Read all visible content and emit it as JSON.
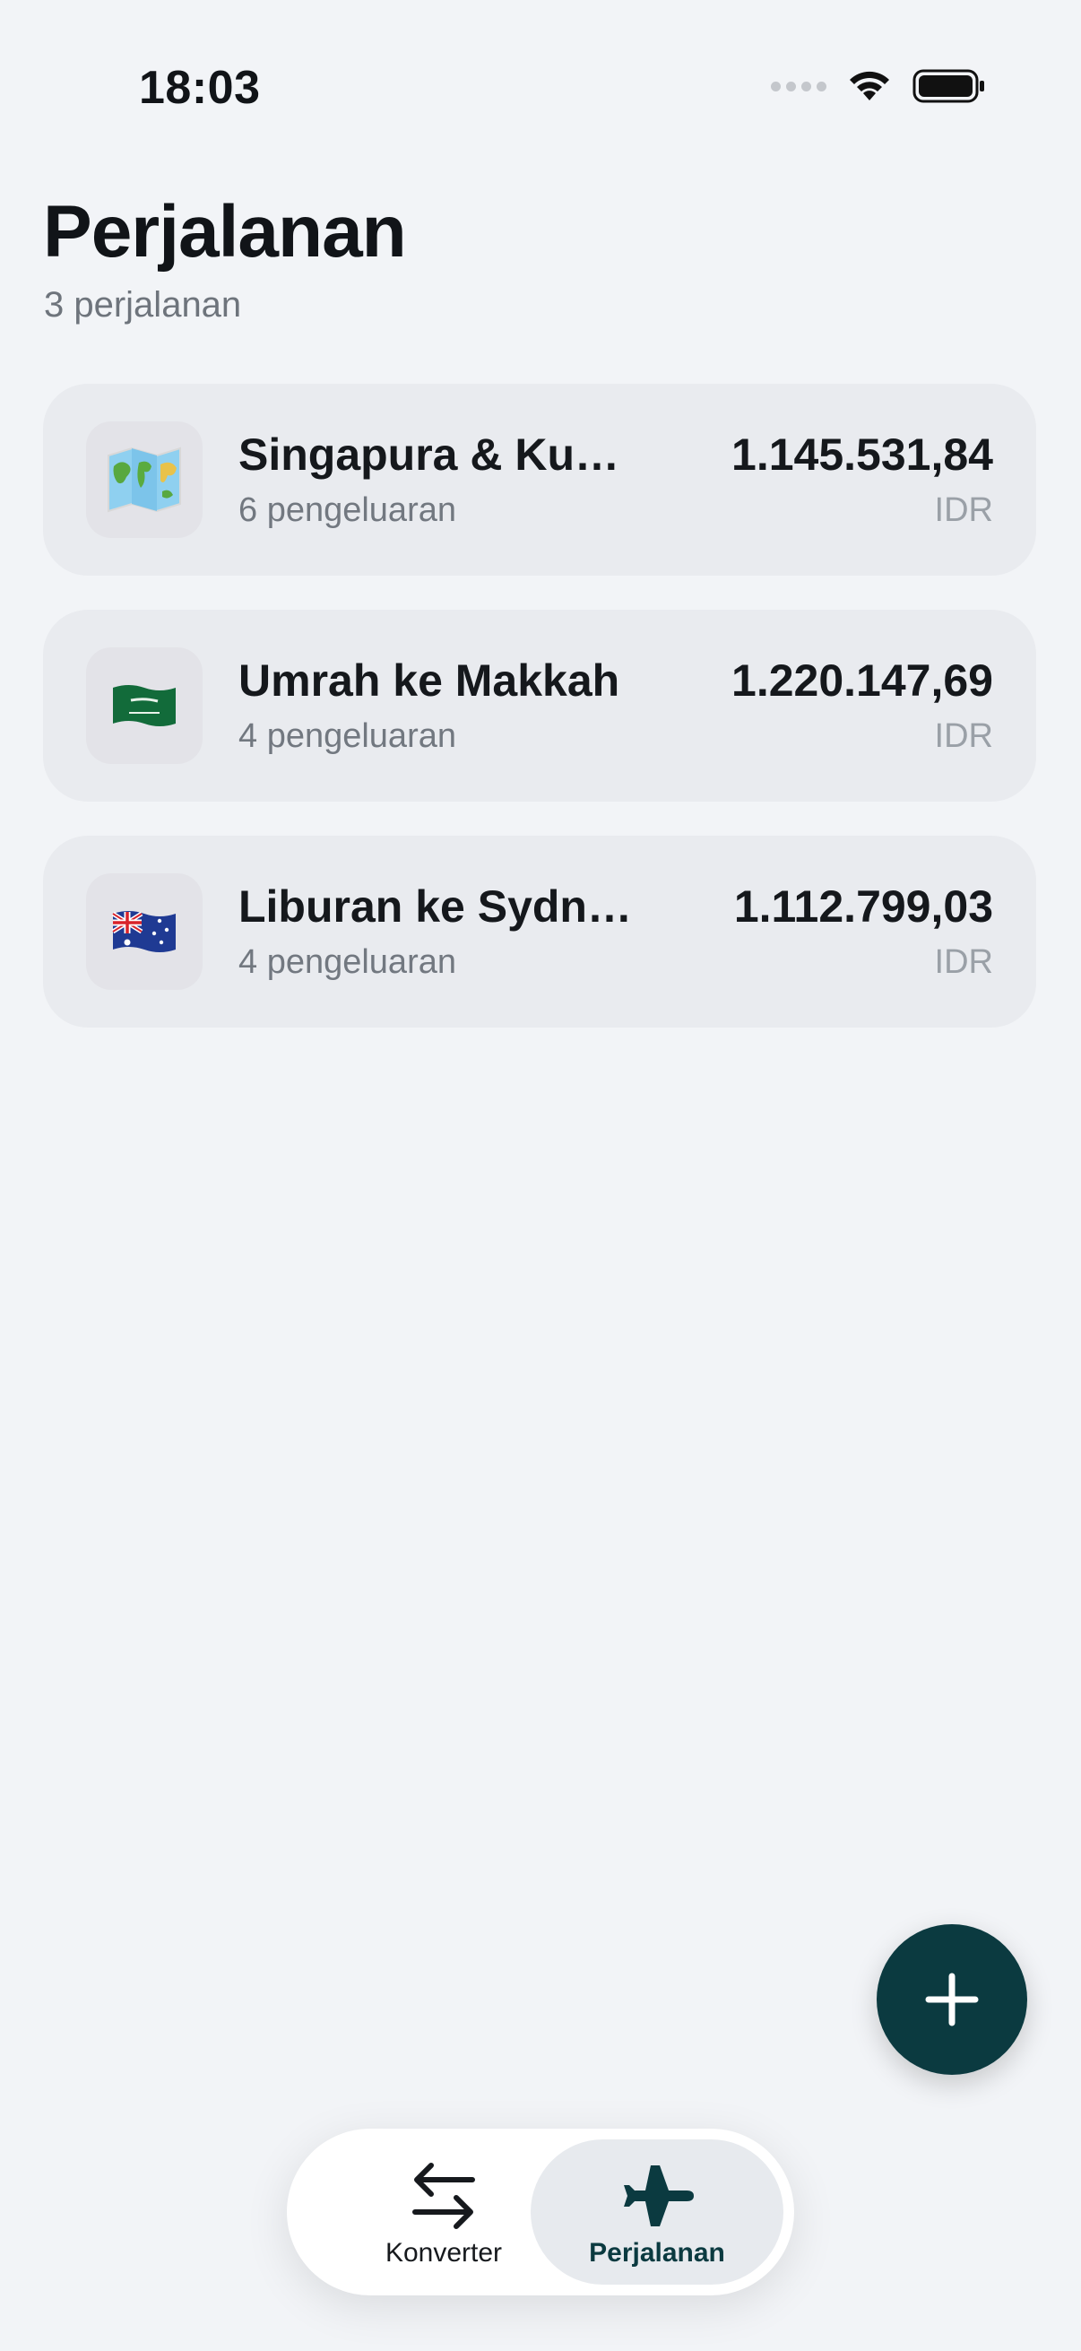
{
  "status_bar": {
    "time": "18:03"
  },
  "header": {
    "title": "Perjalanan",
    "subtitle": "3 perjalanan"
  },
  "trips": [
    {
      "icon": "world-map-icon",
      "name": "Singapura & Kua...",
      "expenses": "6 pengeluaran",
      "amount": "1.145.531,84",
      "currency": "IDR"
    },
    {
      "icon": "saudi-arabia-flag-icon",
      "name": "Umrah ke Makkah",
      "expenses": "4 pengeluaran",
      "amount": "1.220.147,69",
      "currency": "IDR"
    },
    {
      "icon": "australia-flag-icon",
      "name": "Liburan ke Sydney",
      "expenses": "4 pengeluaran",
      "amount": "1.112.799,03",
      "currency": "IDR"
    }
  ],
  "tabbar": {
    "converter_label": "Konverter",
    "trips_label": "Perjalanan",
    "active_tab": "Perjalanan"
  },
  "colors": {
    "background": "#f2f4f7",
    "card": "#e9ebef",
    "accent": "#0b3a40",
    "secondary_text": "#727880"
  }
}
